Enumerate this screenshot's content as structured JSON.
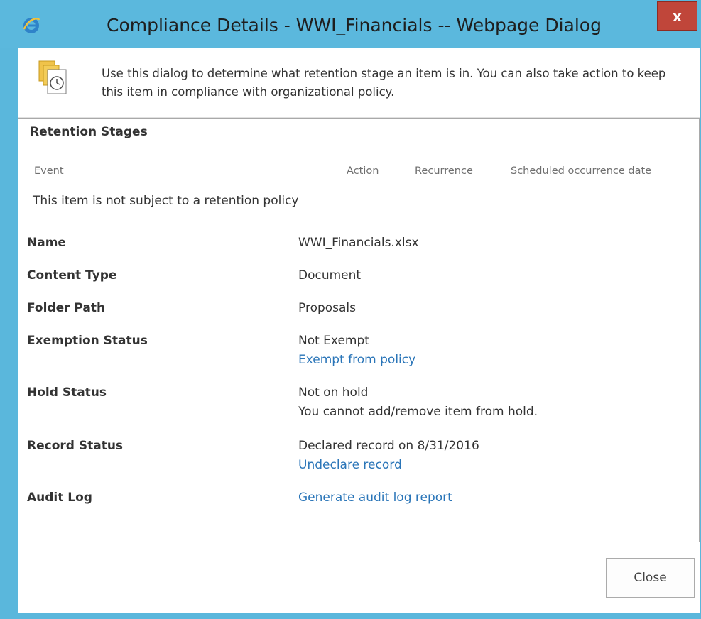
{
  "window": {
    "title": "Compliance Details - WWI_Financials -- Webpage Dialog",
    "close_glyph": "x",
    "titlebar_color": "#5bb8dd",
    "close_color": "#c0463a"
  },
  "intro": {
    "text": "Use this dialog to determine what retention stage an item is in. You can also take action to keep this item in compliance with organizational policy."
  },
  "retention": {
    "title": "Retention Stages",
    "columns": [
      "Event",
      "Action",
      "Recurrence",
      "Scheduled occurrence date"
    ],
    "empty_message": "This item is not subject to a retention policy"
  },
  "details": {
    "name_label": "Name",
    "name_value": "WWI_Financials.xlsx",
    "content_type_label": "Content Type",
    "content_type_value": "Document",
    "folder_path_label": "Folder Path",
    "folder_path_value": "Proposals",
    "exemption_label": "Exemption Status",
    "exemption_value": "Not Exempt",
    "exemption_link": "Exempt from policy",
    "hold_label": "Hold Status",
    "hold_value": "Not on hold",
    "hold_note": "You cannot add/remove item from hold.",
    "record_label": "Record Status",
    "record_value": "Declared record on 8/31/2016",
    "record_link": "Undeclare record",
    "audit_label": "Audit Log",
    "audit_link": "Generate audit log report"
  },
  "footer": {
    "close_label": "Close"
  },
  "colors": {
    "link": "#2a75b8",
    "text": "#333333"
  }
}
